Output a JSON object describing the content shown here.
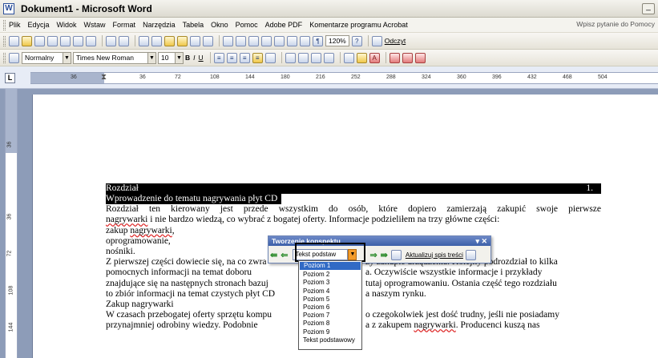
{
  "window": {
    "title": "Dokument1 - Microsoft Word",
    "min_label": "_"
  },
  "menu": {
    "items": [
      "Plik",
      "Edycja",
      "Widok",
      "Wstaw",
      "Format",
      "Narzędzia",
      "Tabela",
      "Okno",
      "Pomoc",
      "Adobe PDF",
      "Komentarze programu Acrobat"
    ],
    "help_placeholder": "Wpisz pytanie do Pomocy"
  },
  "toolbar_standard": {
    "zoom": "120%",
    "read_label": "Odczyt"
  },
  "toolbar_format": {
    "style": "Normalny",
    "font": "Times New Roman",
    "size": "10",
    "bold": "B",
    "italic": "I",
    "underline": "U"
  },
  "ruler": {
    "marks": [
      "36",
      "36",
      "72",
      "108",
      "144",
      "180",
      "216",
      "252",
      "288",
      "324",
      "360",
      "396",
      "432",
      "468",
      "504"
    ],
    "vmarks": [
      "36",
      "36",
      "72",
      "108",
      "144"
    ],
    "tab_selector": "L"
  },
  "document": {
    "heading1": "Rozdział",
    "heading1_num": "1.",
    "heading2": "Wprowadzenie do tematu nagrywania płyt CD",
    "p1a": "Rozdział ten kierowany jest przede wszystkim do osób, które dopiero zamierzają zakupić swoje pierwsze",
    "p1b_word": "nagrywarki",
    "p1b_rest": " i nie bardzo wiedzą, co wybrać z bogatej oferty. Informacje podzieliłem na trzy główne części:",
    "item1_pre": "zakup ",
    "item1_word": "nagrywarki",
    "item1_post": ",",
    "item2": "oprogramowanie,",
    "item3": "nośniki.",
    "p2a": "Z pierwszej części dowiecie się, na co zwra",
    "p2a_end": "ży zakupie urządzenia. Kolejny podrozdział to kilka",
    "p2b": "pomocnych informacji na temat doboru ",
    "p2b_end": "a. Oczywiście wszystkie informacje i przykłady",
    "p2c": "znajdujące się na następnych stronach bazuj",
    "p2c_end": "tutaj oprogramowaniu. Ostania część tego rozdziału",
    "p2d": "to zbiór informacji na temat czystych płyt CD",
    "p2d_end": "a naszym rynku.",
    "heading3": "Zakup nagrywarki",
    "p3a": "W czasach przebogatej oferty sprzętu kompu",
    "p3a_end": "o czegokolwiek jest dość trudny, jeśli nie posiadamy",
    "p3b": "przynajmniej odrobiny wiedzy. Podobnie ",
    "p3b_mid": "a z zakupem ",
    "p3b_word": "nagrywarki",
    "p3b_end": ". Producenci kuszą nas"
  },
  "toc_panel": {
    "title": "Tworzenie konspektu",
    "level_value": "Tekst podstaw",
    "update_label": "Aktualizuj spis treści",
    "options": [
      "Poziom 1",
      "Poziom 2",
      "Poziom 3",
      "Poziom 4",
      "Poziom 5",
      "Poziom 6",
      "Poziom 7",
      "Poziom 8",
      "Poziom 9",
      "Tekst podstawowy"
    ]
  }
}
